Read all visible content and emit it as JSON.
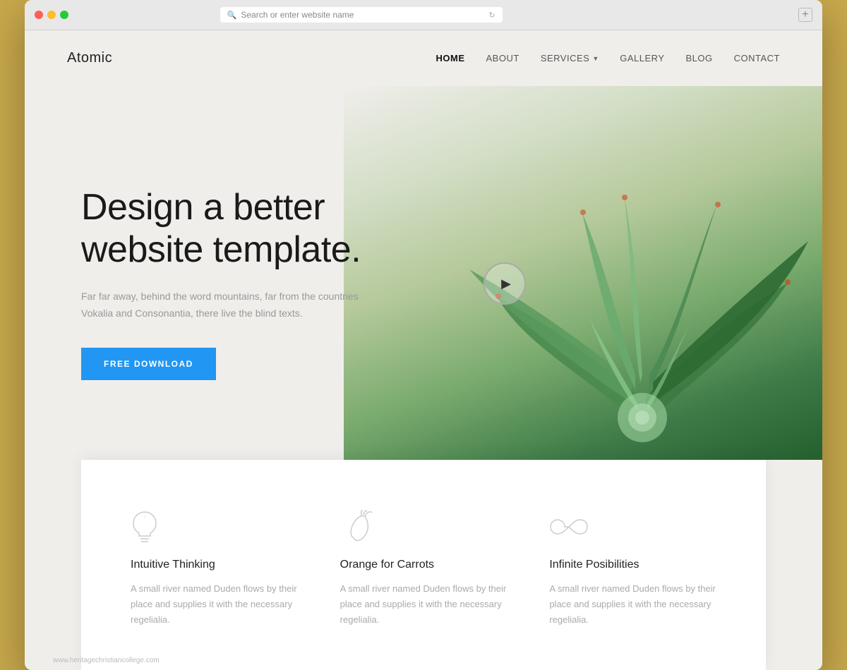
{
  "browser": {
    "address_placeholder": "Search or enter website name",
    "add_tab_icon": "+"
  },
  "nav": {
    "logo": "Atomic",
    "links": [
      {
        "label": "HOME",
        "active": true
      },
      {
        "label": "ABOUT",
        "active": false
      },
      {
        "label": "SERVICES",
        "active": false,
        "has_dropdown": true
      },
      {
        "label": "GALLERY",
        "active": false
      },
      {
        "label": "BLOG",
        "active": false
      },
      {
        "label": "CONTACT",
        "active": false
      }
    ]
  },
  "hero": {
    "title": "Design a better website template.",
    "subtitle": "Far far away, behind the word mountains, far from the countries Vokalia and Consonantia, there live the blind texts.",
    "cta_label": "FREE DOWNLOAD",
    "play_button_label": "Play video"
  },
  "features": [
    {
      "icon": "lightbulb",
      "title": "Intuitive Thinking",
      "description": "A small river named Duden flows by their place and supplies it with the necessary regelialia."
    },
    {
      "icon": "carrot",
      "title": "Orange for Carrots",
      "description": "A small river named Duden flows by their place and supplies it with the necessary regelialia."
    },
    {
      "icon": "infinity",
      "title": "Infinite Posibilities",
      "description": "A small river named Duden flows by their place and supplies it with the necessary regelialia."
    }
  ],
  "watermark": "www.heritagechristiancollege.com",
  "colors": {
    "accent_blue": "#2196F3",
    "nav_active": "#111111",
    "hero_bg": "#f0eeeb",
    "text_dark": "#1a1a1a",
    "text_muted": "#999999"
  }
}
